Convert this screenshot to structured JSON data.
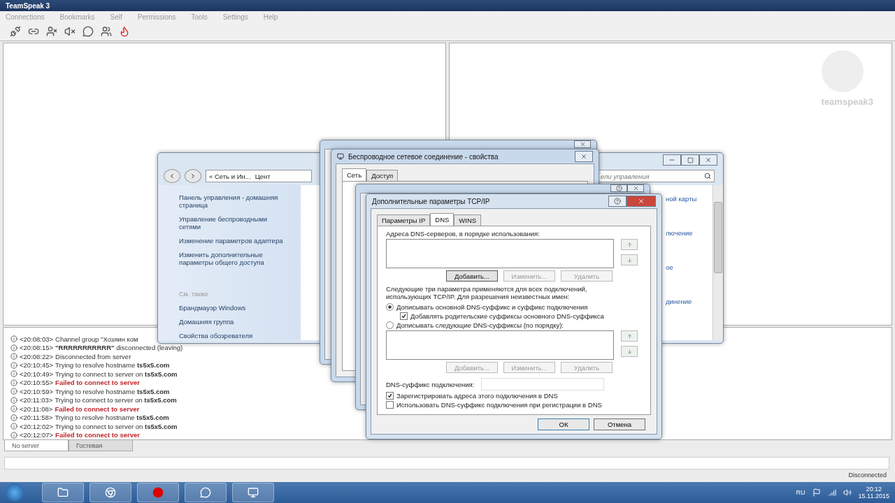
{
  "app": {
    "title": "TeamSpeak 3",
    "menu": [
      "Connections",
      "Bookmarks",
      "Self",
      "Permissions",
      "Tools",
      "Settings",
      "Help"
    ],
    "logo_text": "teamspeak3",
    "status": "Disconnected"
  },
  "log": [
    {
      "kind": "info",
      "time": "<20:08:03>",
      "text": "Channel group \"Хозяин ком"
    },
    {
      "kind": "info",
      "time": "<20:08:15>",
      "text": "**\"RRRRRRRRRRR\"** disconnected (leaving)"
    },
    {
      "kind": "info",
      "time": "<20:08:22>",
      "text": "Disconnected from server"
    },
    {
      "kind": "info",
      "time": "<20:10:45>",
      "text": "Trying to resolve hostname **ts5x5.com**"
    },
    {
      "kind": "info",
      "time": "<20:10:49>",
      "text": "Trying to connect to server on **ts5x5.com**"
    },
    {
      "kind": "error",
      "time": "<20:10:55>",
      "text": "Failed to connect to server"
    },
    {
      "kind": "info",
      "time": "<20:10:59>",
      "text": "Trying to resolve hostname **ts5x5.com**"
    },
    {
      "kind": "info",
      "time": "<20:11:03>",
      "text": "Trying to connect to server on **ts5x5.com**"
    },
    {
      "kind": "error",
      "time": "<20:11:08>",
      "text": "Failed to connect to server"
    },
    {
      "kind": "info",
      "time": "<20:11:58>",
      "text": "Trying to resolve hostname **ts5x5.com**"
    },
    {
      "kind": "info",
      "time": "<20:12:02>",
      "text": "Trying to connect to server on **ts5x5.com**"
    },
    {
      "kind": "error",
      "time": "<20:12:07>",
      "text": "Failed to connect to server"
    }
  ],
  "server_tabs": [
    {
      "label": "No server",
      "selected": true
    },
    {
      "label": "Гостевая",
      "selected": false
    }
  ],
  "explorer": {
    "breadcrumb": [
      "« Сеть и Ин...",
      "Цент"
    ],
    "links": [
      "Панель управления - домашняя страница",
      "Управление беспроводными сетями",
      "Изменение параметров адаптера",
      "Изменить дополнительные параметры общего доступа"
    ],
    "see_also_label": "См. также",
    "see_also": [
      "Брандмауэр Windows",
      "Домашняя группа",
      "Свойства обозревателя"
    ],
    "search_placeholder": "ели управления",
    "content_links": [
      "ной карты",
      "лючение",
      "ое",
      "динение"
    ]
  },
  "properties": {
    "title": "Беспроводное сетевое соединение - свойства",
    "tabs": [
      {
        "label": "Сеть",
        "selected": true
      },
      {
        "label": "Доступ",
        "selected": false
      }
    ]
  },
  "advanced": {
    "title": "Дополнительные параметры TCP/IP",
    "tabs": [
      {
        "label": "Параметры IP",
        "selected": false
      },
      {
        "label": "DNS",
        "selected": true
      },
      {
        "label": "WINS",
        "selected": false
      }
    ],
    "dns_servers_label": "Адреса DNS-серверов, в порядке использования:",
    "dns_buttons": [
      {
        "label": "Добавить...",
        "disabled": false
      },
      {
        "label": "Изменить...",
        "disabled": true
      },
      {
        "label": "Удалить",
        "disabled": true
      }
    ],
    "note": "Следующие три параметра применяются для всех подключений, использующих TCP/IP. Для разрешения неизвестных имен:",
    "suffix_mode": [
      {
        "label": "Дописывать основной DNS-суффикс и суффикс подключения",
        "selected": true
      },
      {
        "label": "Дописывать следующие DNS-суффиксы (по порядку):",
        "selected": false
      }
    ],
    "append_parent": {
      "label": "Добавлять родительские суффиксы основного DNS-суффикса",
      "checked": true
    },
    "suffix_buttons": [
      {
        "label": "Добавить...",
        "disabled": true
      },
      {
        "label": "Изменить...",
        "disabled": true
      },
      {
        "label": "Удалить",
        "disabled": true
      }
    ],
    "suffix_label": "DNS-суффикс подключения:",
    "checks": [
      {
        "label": "Зарегистрировать адреса этого подключения в DNS",
        "checked": true
      },
      {
        "label": "Использовать DNS-суффикс подключения при регистрации в DNS",
        "checked": false
      }
    ],
    "buttons": [
      {
        "label": "ОК",
        "default": true
      },
      {
        "label": "Отмена",
        "default": false
      }
    ]
  },
  "taskbar": {
    "language": "RU",
    "time": "20:12",
    "date": "15.11.2015"
  }
}
